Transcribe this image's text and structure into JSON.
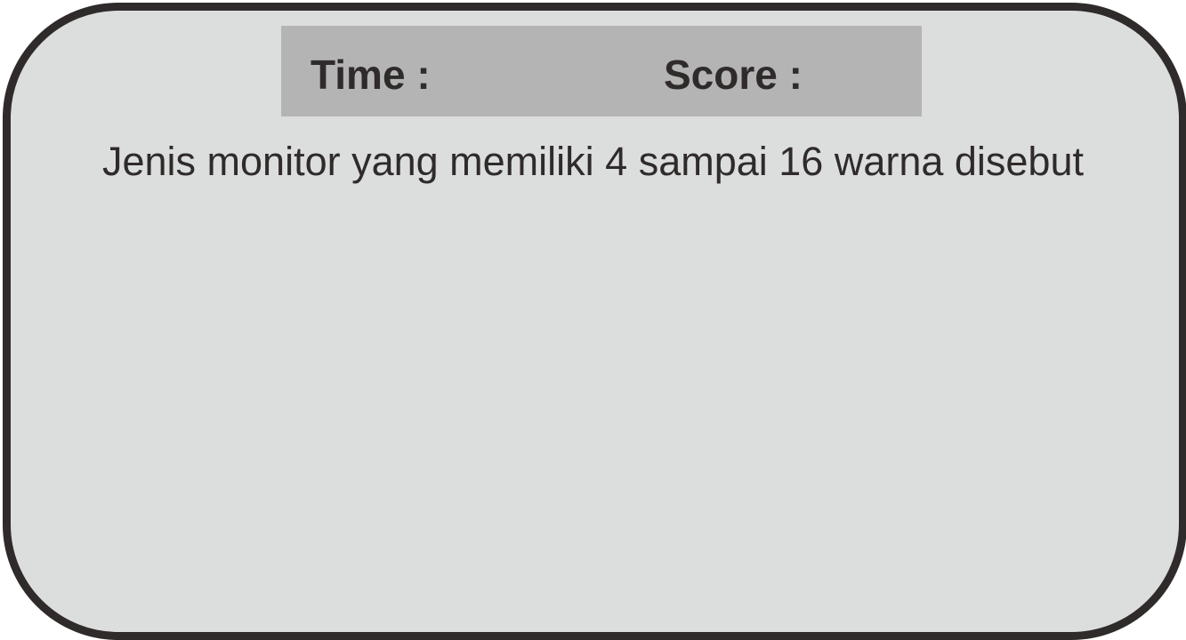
{
  "hud": {
    "time_label": "Time :",
    "score_label": "Score :"
  },
  "question": {
    "text": "Jenis monitor yang memiliki 4 sampai 16 warna disebut"
  },
  "colors": {
    "frame_border": "#302b2b",
    "frame_fill": "#dcdedd",
    "hud_fill": "#b4b4b4",
    "text": "#302b2b"
  }
}
